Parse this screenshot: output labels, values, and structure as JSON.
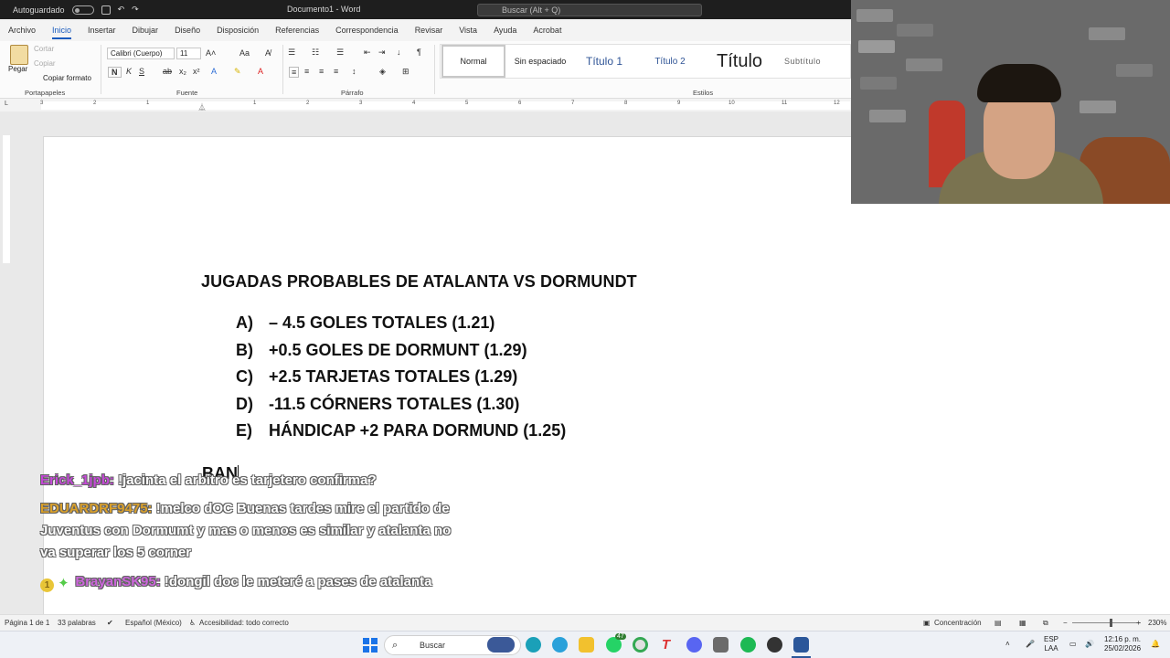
{
  "titlebar": {
    "autosave_label": "Autoguardado",
    "doc_title": "Documento1 - Word",
    "search_placeholder": "Buscar (Alt + Q)"
  },
  "tabs": [
    "Archivo",
    "Inicio",
    "Insertar",
    "Dibujar",
    "Diseño",
    "Disposición",
    "Referencias",
    "Correspondencia",
    "Revisar",
    "Vista",
    "Ayuda",
    "Acrobat"
  ],
  "active_tab": "Inicio",
  "ribbon": {
    "clipboard": {
      "paste": "Pegar",
      "cut": "Cortar",
      "copy": "Copiar",
      "format_painter": "Copiar formato",
      "label": "Portapapeles"
    },
    "font": {
      "name": "Calibri (Cuerpo)",
      "size": "11",
      "label": "Fuente"
    },
    "paragraph": {
      "label": "Párrafo"
    },
    "styles": {
      "items": [
        "Normal",
        "Sin espaciado",
        "Título 1",
        "Título 2",
        "Título",
        "Subtítulo"
      ],
      "label": "Estilos"
    }
  },
  "ruler_numbers": [
    "3",
    "2",
    "1",
    "1",
    "2",
    "3",
    "4",
    "5",
    "6",
    "7",
    "8",
    "9",
    "10",
    "11",
    "12"
  ],
  "document": {
    "title": "JUGADAS PROBABLES DE ATALANTA VS DORMUNDT",
    "options": [
      {
        "letter": "A)",
        "text": "– 4.5 GOLES TOTALES (1.21)"
      },
      {
        "letter": "B)",
        "text": "+0.5 GOLES DE DORMUNT (1.29)"
      },
      {
        "letter": "C)",
        "text": "+2.5 TARJETAS TOTALES (1.29)"
      },
      {
        "letter": "D)",
        "text": "-11.5 CÓRNERS TOTALES (1.30)"
      },
      {
        "letter": "E)",
        "text": "HÁNDICAP +2 PARA DORMUND (1.25)"
      }
    ],
    "typing": "BAN"
  },
  "chat": [
    {
      "user": "Erick_1jpb:",
      "message": " !jacinta el arbitro es tarjetero confirma?"
    },
    {
      "user": "EDUARDRF9475:",
      "message": " !melco dOC Buenas tardes mire el partido de",
      "line2": "Juventus con Dormumt y mas o menos es similar y atalanta no",
      "line3": "va superar los 5 corner"
    },
    {
      "badge": "1",
      "user": "BrayanSK95:",
      "message": " !dongil doc le meteré a pases de atalanta"
    }
  ],
  "statusbar": {
    "page": "Página 1 de 1",
    "words": "33 palabras",
    "language": "Español (México)",
    "accessibility": "Accesibilidad: todo correcto",
    "focus": "Concentración",
    "zoom": "230%"
  },
  "taskbar": {
    "search": "Buscar",
    "whatsapp_badge": "47",
    "lang_line1": "ESP",
    "lang_line2": "LAA",
    "time": "12:16 p. m.",
    "date": "25/02/2026"
  }
}
